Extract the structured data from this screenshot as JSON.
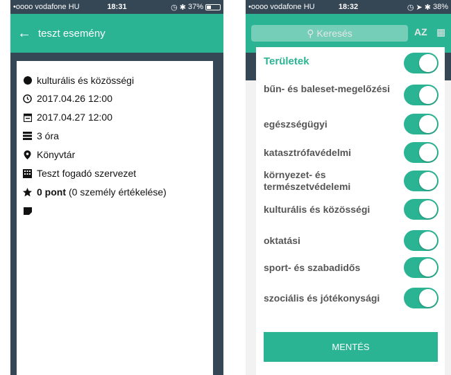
{
  "left_screen": {
    "status": {
      "carrier": "•oooo vodafone HU",
      "time": "18:31",
      "battery": "37%",
      "battery_level": 0.37
    },
    "appbar": {
      "back_icon": "arrow-left-icon",
      "title": "teszt esemény"
    },
    "details": {
      "category": "kulturális és közösségi",
      "start": "2017.04.26 12:00",
      "end": "2017.04.27 12:00",
      "duration": "3 óra",
      "location": "Könyvtár",
      "organization": "Teszt fogadó szervezet",
      "rating_points": "0 pont",
      "rating_count": "(0 személy értékelése)"
    }
  },
  "right_screen": {
    "status": {
      "carrier": "•oooo vodafone HU",
      "time": "18:32",
      "battery": "38%",
      "battery_level": 0.38
    },
    "search": {
      "placeholder": "Keresés",
      "sort_label": "AZ"
    },
    "modal": {
      "title": "Területek",
      "all_enabled": true,
      "categories": [
        {
          "label": "bűn- és baleset-megelőzési",
          "enabled": true
        },
        {
          "label": "egészségügyi",
          "enabled": true
        },
        {
          "label": "katasztrófavédelmi",
          "enabled": true
        },
        {
          "label": "környezet- és természetvédelemi",
          "enabled": true
        },
        {
          "label": "kulturális és közösségi",
          "enabled": true
        },
        {
          "label": "oktatási",
          "enabled": true
        },
        {
          "label": "sport- és szabadidős",
          "enabled": true
        },
        {
          "label": "szociális és jótékonysági",
          "enabled": true
        }
      ],
      "save_label": "MENTÉS"
    }
  },
  "colors": {
    "accent": "#2ab493",
    "background_dark": "#354655",
    "label_gray": "#555555"
  }
}
